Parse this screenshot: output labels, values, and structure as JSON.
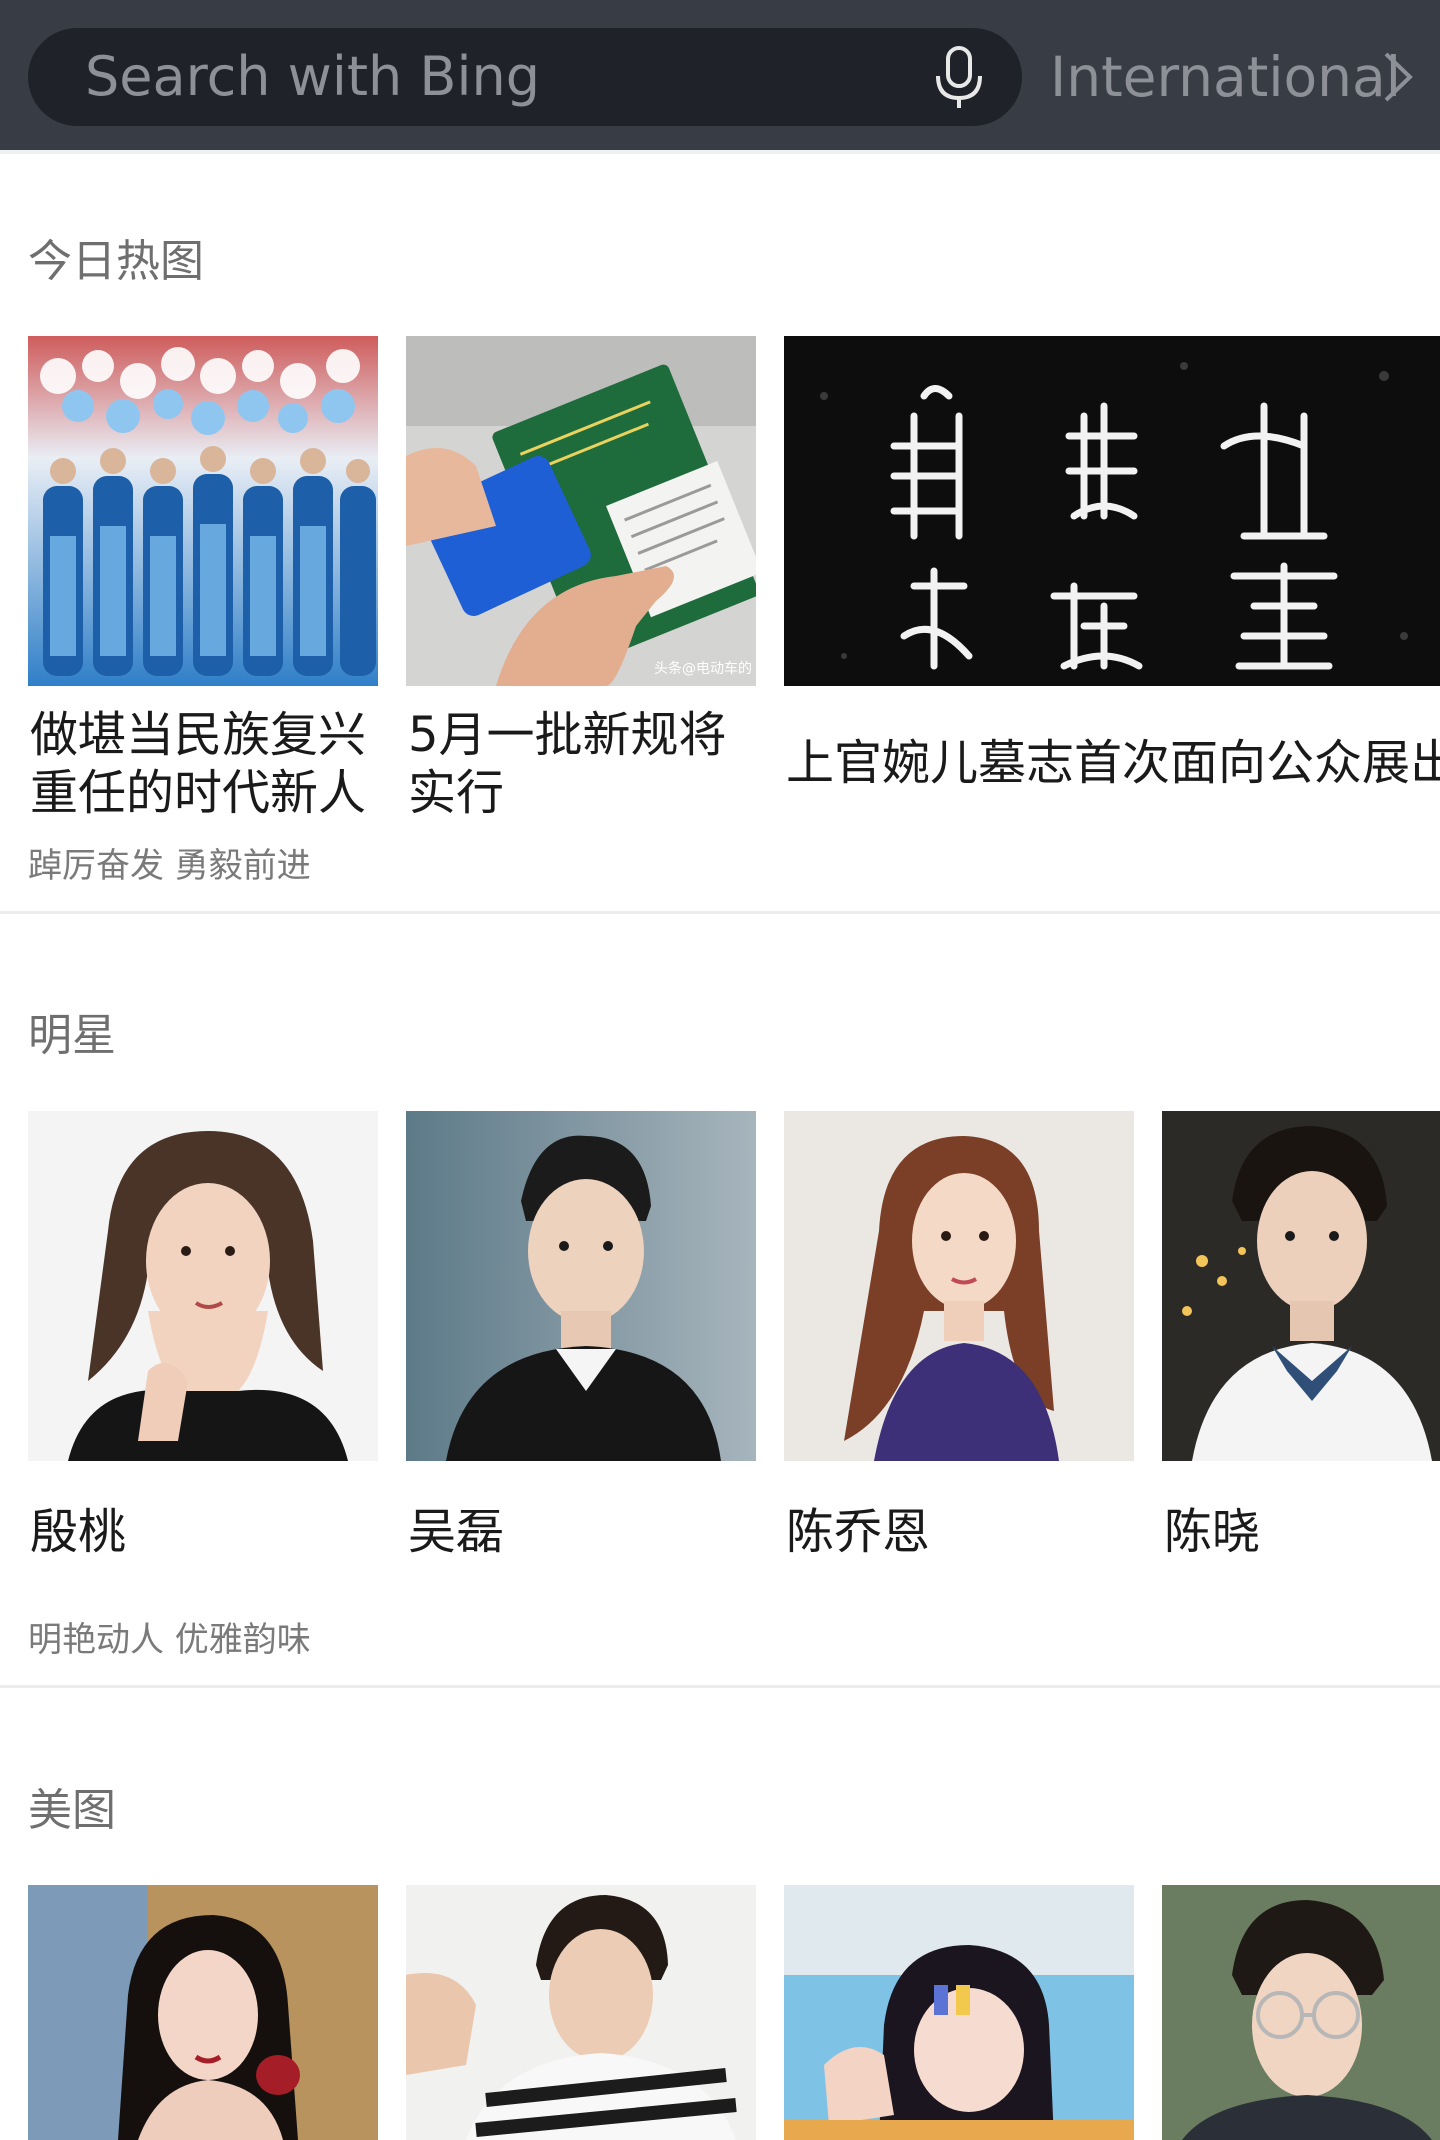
{
  "header": {
    "search_placeholder": "Search with Bing",
    "mic_icon": "microphone-icon",
    "region_label": "International",
    "chevron_icon": "chevron-right-icon",
    "background_color": "#383c45",
    "pill_color": "#1f2228"
  },
  "sections": [
    {
      "title": "今日热图",
      "cards": [
        {
          "caption_line1": "做堪当民族复兴",
          "caption_line2": "重任的时代新人"
        },
        {
          "caption_line1": "5月一批新规将",
          "caption_line2": "实行",
          "watermark": "头条@电动车的"
        },
        {
          "caption_line1": "上官婉儿墓志首次面向公众展出"
        }
      ],
      "subcaption": "踔厉奋发 勇毅前进"
    },
    {
      "title": "明星",
      "cards": [
        {
          "name": "殷桃"
        },
        {
          "name": "吴磊"
        },
        {
          "name": "陈乔恩"
        },
        {
          "name": "陈晓"
        }
      ],
      "subcaption": "明艳动人 优雅韵味"
    },
    {
      "title": "美图",
      "cards": [
        {
          "name": ""
        },
        {
          "name": ""
        },
        {
          "name": ""
        },
        {
          "name": ""
        }
      ]
    }
  ]
}
